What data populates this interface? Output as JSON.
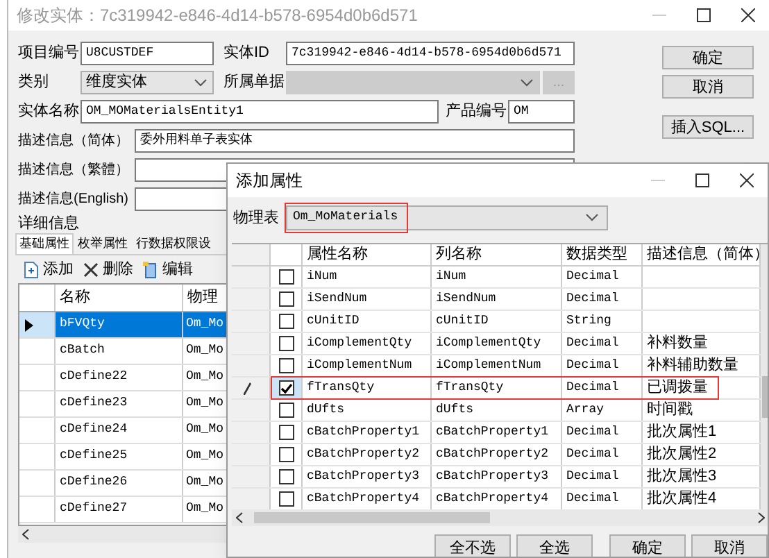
{
  "main_window": {
    "title": "修改实体：7c319942-e846-4d14-b578-6954d0b6d571",
    "project_code": {
      "label": "项目编号",
      "value": "U8CUSTDEF"
    },
    "entity_id": {
      "label": "实体ID",
      "value": "7c319942-e846-4d14-b578-6954d0b6d571"
    },
    "category": {
      "label": "类别",
      "value": "维度实体"
    },
    "owner_document": {
      "label": "所属单据",
      "disabled": true,
      "button": "..."
    },
    "entity_name": {
      "label": "实体名称",
      "value": "OM_MOMaterialsEntity1"
    },
    "product_code": {
      "label": "产品编号",
      "value": "OM"
    },
    "descriptions": [
      {
        "label": "描述信息（简体）",
        "value": "委外用料单子表实体"
      },
      {
        "label": "描述信息（繁體）"
      },
      {
        "label": "描述信息(English)"
      }
    ],
    "buttons": [
      "确定",
      "取消",
      "插入SQL..."
    ],
    "section_title": "详细信息",
    "tabs": [
      {
        "label": "基础属性",
        "selected": true
      },
      {
        "label": "枚举属性",
        "selected": false
      },
      {
        "label": "行数据权限设",
        "selected": false
      }
    ],
    "toolbar": [
      {
        "kind": "add",
        "label": "添加"
      },
      {
        "kind": "delete",
        "label": "删除"
      },
      {
        "kind": "edit",
        "label": "编辑"
      }
    ],
    "grid": {
      "columns": [
        "名称",
        "物理"
      ],
      "rows": [
        {
          "name": "bFVQty",
          "table": "Om_Mo",
          "selected": true
        },
        {
          "name": "cBatch",
          "table": "Om_Mo",
          "selected": false
        },
        {
          "name": "cDefine22",
          "table": "Om_Mo",
          "selected": false
        },
        {
          "name": "cDefine23",
          "table": "Om_Mo",
          "selected": false
        },
        {
          "name": "cDefine24",
          "table": "Om_Mo",
          "selected": false
        },
        {
          "name": "cDefine25",
          "table": "Om_Mo",
          "selected": false
        },
        {
          "name": "cDefine26",
          "table": "Om_Mo",
          "selected": false
        },
        {
          "name": "cDefine27",
          "table": "Om_Mo",
          "selected": false
        }
      ]
    }
  },
  "dialog": {
    "title": "添加属性",
    "table_label": "物理表",
    "table_value": "Om_MoMaterials",
    "table_highlighted": true,
    "grid": {
      "columns": [
        "属性名称",
        "列名称",
        "数据类型",
        "描述信息（简体）"
      ],
      "rows": [
        {
          "property": "iNum",
          "column": "iNum",
          "type": "Decimal",
          "checked": false,
          "editing": false,
          "highlighted": false
        },
        {
          "property": "iSendNum",
          "column": "iSendNum",
          "type": "Decimal",
          "checked": false,
          "editing": false,
          "highlighted": false
        },
        {
          "property": "cUnitID",
          "column": "cUnitID",
          "type": "String",
          "checked": false,
          "editing": false,
          "highlighted": false
        },
        {
          "property": "iComplementQty",
          "column": "iComplementQty",
          "type": "Decimal",
          "description": "补料数量",
          "checked": false,
          "editing": false,
          "highlighted": false
        },
        {
          "property": "iComplementNum",
          "column": "iComplementNum",
          "type": "Decimal",
          "description": "补料辅助数量",
          "checked": false,
          "editing": false,
          "highlighted": false
        },
        {
          "property": "fTransQty",
          "column": "fTransQty",
          "type": "Decimal",
          "description": "已调拨量",
          "checked": true,
          "editing": true,
          "highlighted": true
        },
        {
          "property": "dUfts",
          "column": "dUfts",
          "type": "Array",
          "description": "时间戳",
          "checked": false,
          "editing": false,
          "highlighted": false
        },
        {
          "property": "cBatchProperty1",
          "column": "cBatchProperty1",
          "type": "Decimal",
          "description": "批次属性1",
          "checked": false,
          "editing": false,
          "highlighted": false
        },
        {
          "property": "cBatchProperty2",
          "column": "cBatchProperty2",
          "type": "Decimal",
          "description": "批次属性2",
          "checked": false,
          "editing": false,
          "highlighted": false
        },
        {
          "property": "cBatchProperty3",
          "column": "cBatchProperty3",
          "type": "Decimal",
          "description": "批次属性3",
          "checked": false,
          "editing": false,
          "highlighted": false
        },
        {
          "property": "cBatchProperty4",
          "column": "cBatchProperty4",
          "type": "Decimal",
          "description": "批次属性4",
          "checked": false,
          "editing": false,
          "highlighted": false
        }
      ]
    },
    "buttons": [
      "全不选",
      "全选",
      "确定",
      "取消"
    ]
  }
}
